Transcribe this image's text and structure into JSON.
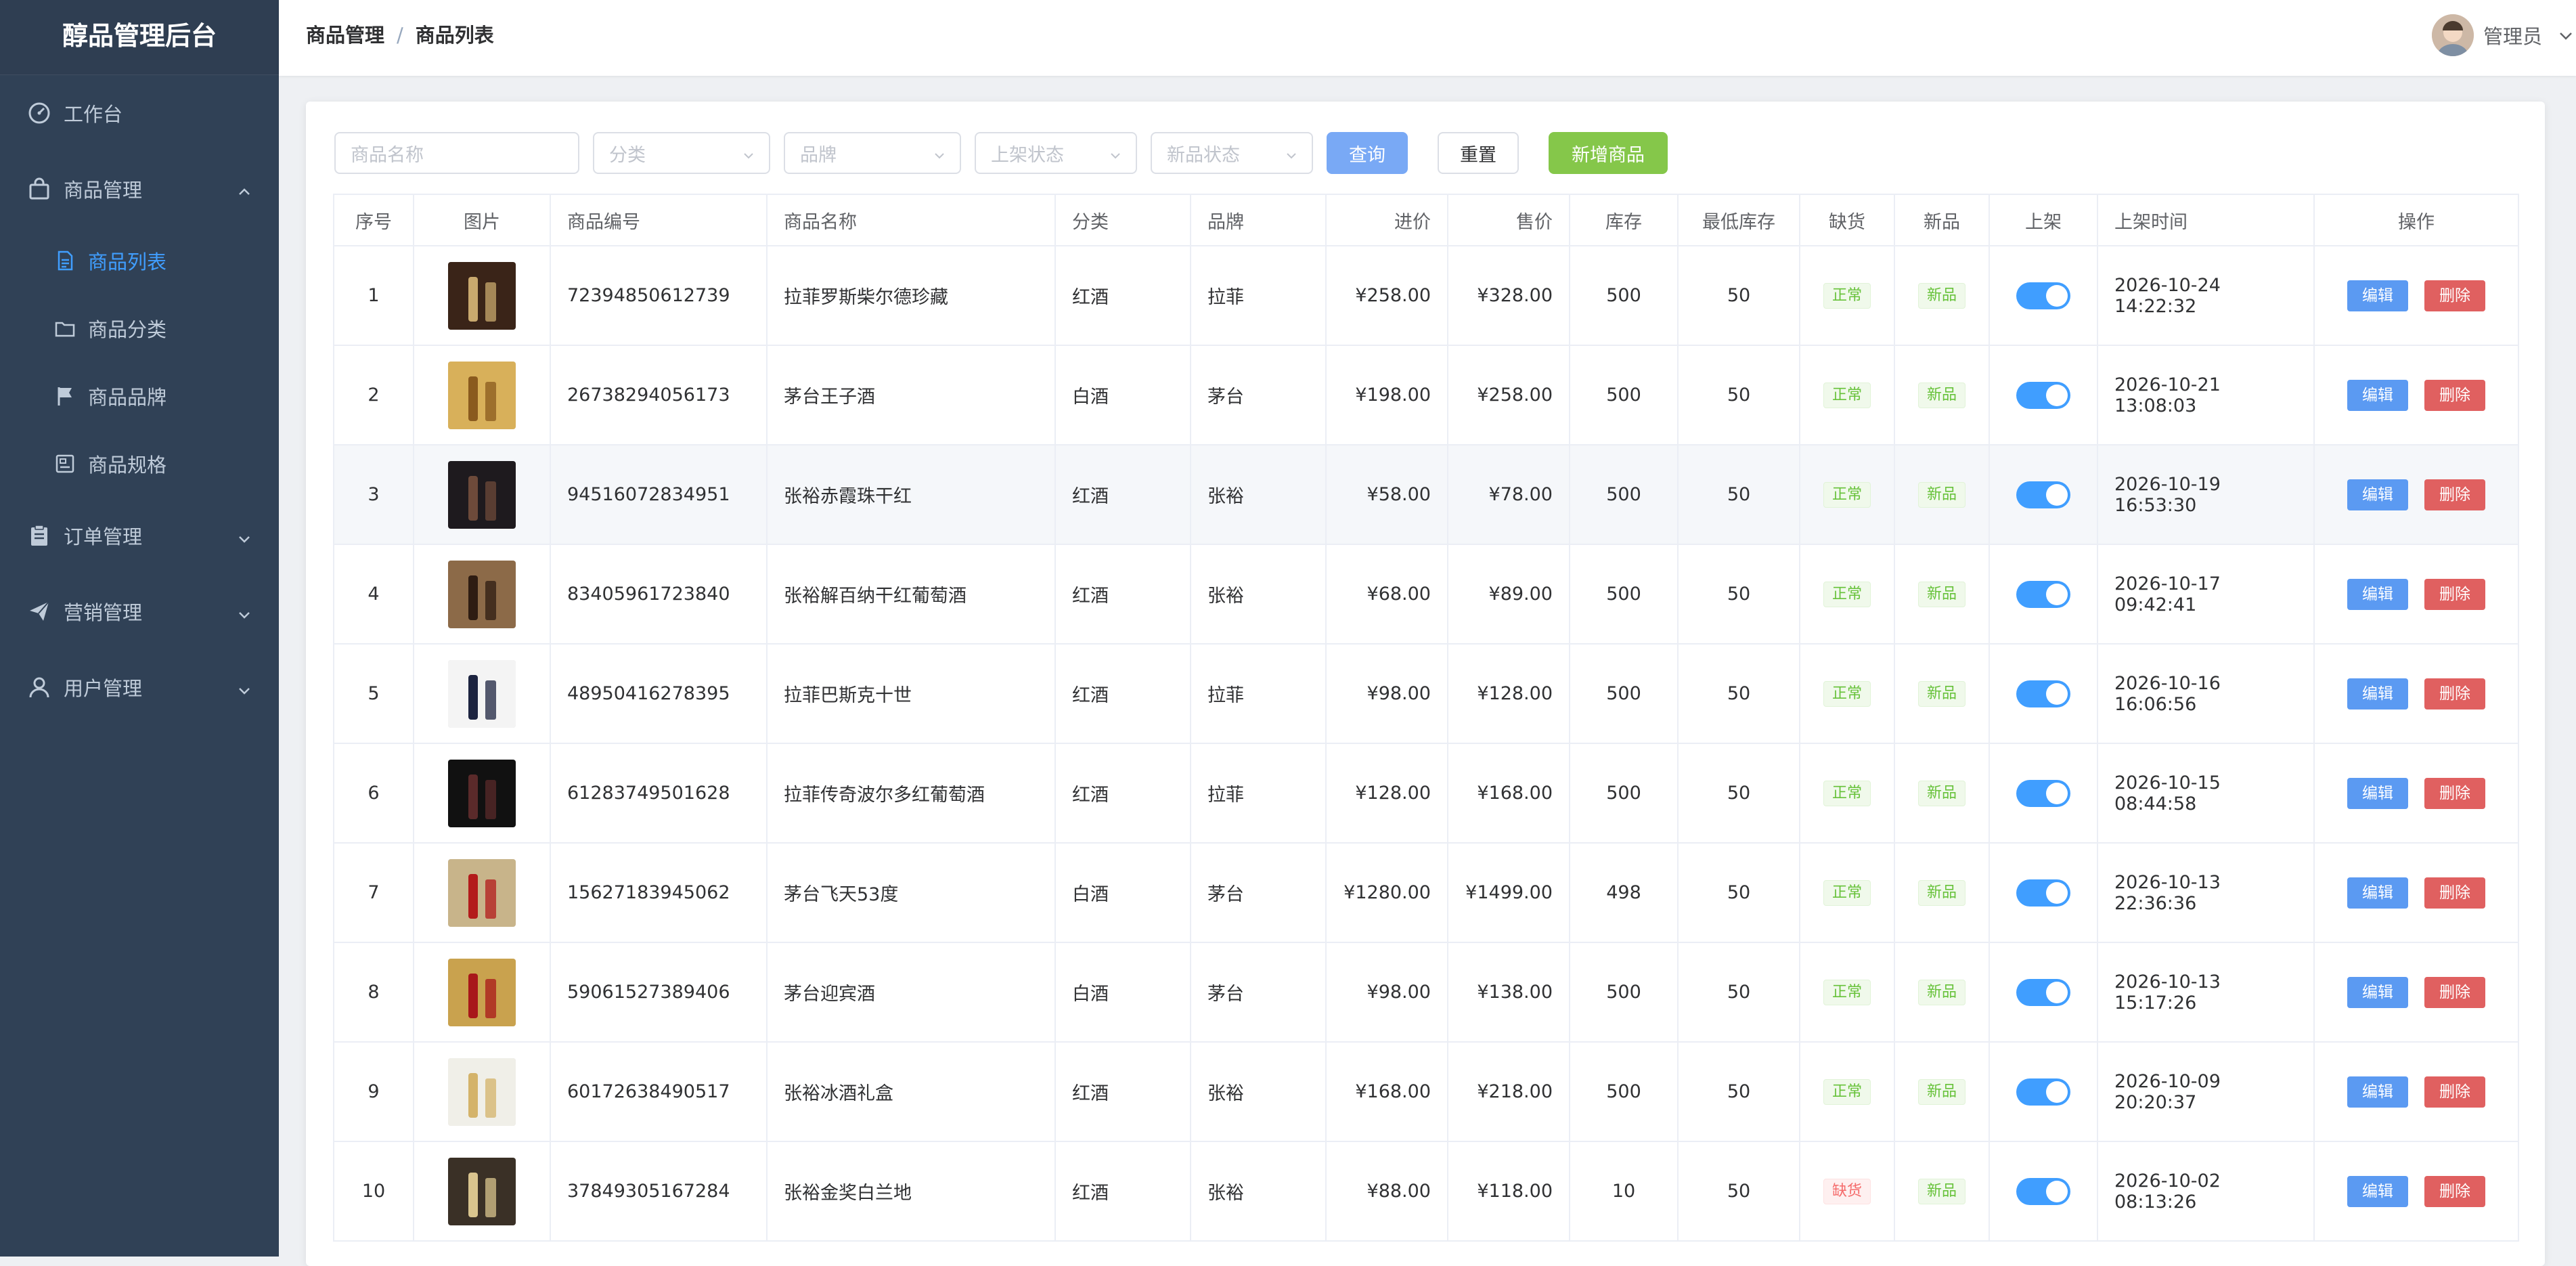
{
  "app": {
    "title": "醇品管理后台"
  },
  "sidebar": {
    "items": [
      {
        "label": "工作台",
        "icon": "dashboard-icon"
      },
      {
        "label": "商品管理",
        "icon": "shopping-bag-icon",
        "expanded": true,
        "children": [
          {
            "label": "商品列表",
            "icon": "document-icon",
            "active": true
          },
          {
            "label": "商品分类",
            "icon": "folder-icon"
          },
          {
            "label": "商品品牌",
            "icon": "flag-icon"
          },
          {
            "label": "商品规格",
            "icon": "spec-icon"
          }
        ]
      },
      {
        "label": "订单管理",
        "icon": "clipboard-icon"
      },
      {
        "label": "营销管理",
        "icon": "send-icon"
      },
      {
        "label": "用户管理",
        "icon": "user-icon"
      }
    ]
  },
  "header": {
    "breadcrumb": [
      "商品管理",
      "商品列表"
    ],
    "user": "管理员"
  },
  "filters": {
    "name_placeholder": "商品名称",
    "category_placeholder": "分类",
    "brand_placeholder": "品牌",
    "shelf_placeholder": "上架状态",
    "new_placeholder": "新品状态",
    "query": "查询",
    "reset": "重置",
    "add": "新增商品"
  },
  "table": {
    "columns": [
      "序号",
      "图片",
      "商品编号",
      "商品名称",
      "分类",
      "品牌",
      "进价",
      "售价",
      "库存",
      "最低库存",
      "缺货",
      "新品",
      "上架",
      "上架时间",
      "操作"
    ],
    "edit_label": "编辑",
    "delete_label": "删除",
    "rows": [
      {
        "no": "1",
        "code": "72394850612739",
        "name": "拉菲罗斯柴尔德珍藏",
        "category": "红酒",
        "brand": "拉菲",
        "cost": "¥258.00",
        "price": "¥328.00",
        "stock": "500",
        "min_stock": "50",
        "shortage": "正常",
        "shortage_status": "normal",
        "new": "新品",
        "on_shelf": true,
        "time": "2026-10-24 14:22:32"
      },
      {
        "no": "2",
        "code": "26738294056173",
        "name": "茅台王子酒",
        "category": "白酒",
        "brand": "茅台",
        "cost": "¥198.00",
        "price": "¥258.00",
        "stock": "500",
        "min_stock": "50",
        "shortage": "正常",
        "shortage_status": "normal",
        "new": "新品",
        "on_shelf": true,
        "time": "2026-10-21 13:08:03"
      },
      {
        "no": "3",
        "code": "94516072834951",
        "name": "张裕赤霞珠干红",
        "category": "红酒",
        "brand": "张裕",
        "cost": "¥58.00",
        "price": "¥78.00",
        "stock": "500",
        "min_stock": "50",
        "shortage": "正常",
        "shortage_status": "normal",
        "new": "新品",
        "on_shelf": true,
        "time": "2026-10-19 16:53:30"
      },
      {
        "no": "4",
        "code": "83405961723840",
        "name": "张裕解百纳干红葡萄酒",
        "category": "红酒",
        "brand": "张裕",
        "cost": "¥68.00",
        "price": "¥89.00",
        "stock": "500",
        "min_stock": "50",
        "shortage": "正常",
        "shortage_status": "normal",
        "new": "新品",
        "on_shelf": true,
        "time": "2026-10-17 09:42:41"
      },
      {
        "no": "5",
        "code": "48950416278395",
        "name": "拉菲巴斯克十世",
        "category": "红酒",
        "brand": "拉菲",
        "cost": "¥98.00",
        "price": "¥128.00",
        "stock": "500",
        "min_stock": "50",
        "shortage": "正常",
        "shortage_status": "normal",
        "new": "新品",
        "on_shelf": true,
        "time": "2026-10-16 16:06:56"
      },
      {
        "no": "6",
        "code": "61283749501628",
        "name": "拉菲传奇波尔多红葡萄酒",
        "category": "红酒",
        "brand": "拉菲",
        "cost": "¥128.00",
        "price": "¥168.00",
        "stock": "500",
        "min_stock": "50",
        "shortage": "正常",
        "shortage_status": "normal",
        "new": "新品",
        "on_shelf": true,
        "time": "2026-10-15 08:44:58"
      },
      {
        "no": "7",
        "code": "15627183945062",
        "name": "茅台飞天53度",
        "category": "白酒",
        "brand": "茅台",
        "cost": "¥1280.00",
        "price": "¥1499.00",
        "stock": "498",
        "min_stock": "50",
        "shortage": "正常",
        "shortage_status": "normal",
        "new": "新品",
        "on_shelf": true,
        "time": "2026-10-13 22:36:36"
      },
      {
        "no": "8",
        "code": "59061527389406",
        "name": "茅台迎宾酒",
        "category": "白酒",
        "brand": "茅台",
        "cost": "¥98.00",
        "price": "¥138.00",
        "stock": "500",
        "min_stock": "50",
        "shortage": "正常",
        "shortage_status": "normal",
        "new": "新品",
        "on_shelf": true,
        "time": "2026-10-13 15:17:26"
      },
      {
        "no": "9",
        "code": "60172638490517",
        "name": "张裕冰酒礼盒",
        "category": "红酒",
        "brand": "张裕",
        "cost": "¥168.00",
        "price": "¥218.00",
        "stock": "500",
        "min_stock": "50",
        "shortage": "正常",
        "shortage_status": "normal",
        "new": "新品",
        "on_shelf": true,
        "time": "2026-10-09 20:20:37"
      },
      {
        "no": "10",
        "code": "37849305167284",
        "name": "张裕金奖白兰地",
        "category": "红酒",
        "brand": "张裕",
        "cost": "¥88.00",
        "price": "¥118.00",
        "stock": "10",
        "min_stock": "50",
        "shortage": "缺货",
        "shortage_status": "shortage",
        "new": "新品",
        "on_shelf": true,
        "time": "2026-10-02 08:13:26"
      }
    ]
  },
  "colors": {
    "sidebar_bg": "#304156",
    "accent": "#409eff",
    "success": "#85c74a",
    "danger": "#e06060"
  }
}
